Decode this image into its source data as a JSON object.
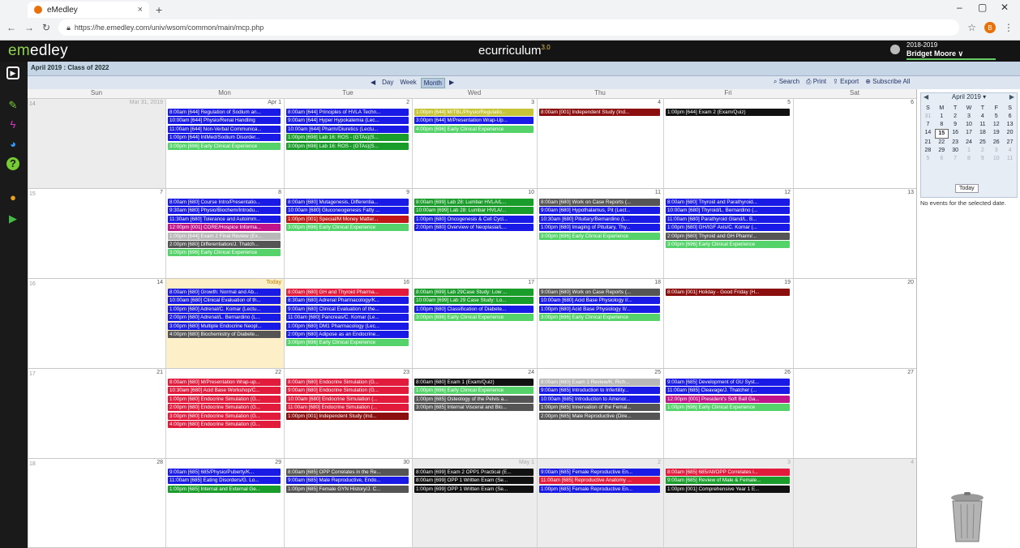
{
  "browser": {
    "tab_title": "eMedley",
    "tab_close": "×",
    "new_tab": "+",
    "url": "https://he.emedley.com/univ/wsom/common/main/mcp.php",
    "profile_initial": "B"
  },
  "app": {
    "logo_em": "em",
    "logo_rest": "edley",
    "title": "ecurriculum",
    "title_sup": "3.0",
    "year": "2018-2019",
    "user": "Bridget Moore ∨"
  },
  "breadcrumb": "April 2019 : Class of 2022",
  "views": {
    "prev": "◀",
    "day": "Day",
    "week": "Week",
    "month": "Month",
    "next": "▶"
  },
  "tools": {
    "search": "Search",
    "print": "Print",
    "export": "Export",
    "subscribe": "Subscribe All"
  },
  "day_headers": [
    "Sun",
    "Mon",
    "Tue",
    "Wed",
    "Thu",
    "Fri",
    "Sat"
  ],
  "weeks": [
    {
      "num": "14",
      "days": [
        {
          "num": "Mar 31, 2019",
          "grey": true,
          "events": []
        },
        {
          "num": "Apr 1",
          "events": [
            {
              "t": "8:00am [644] Regulation of Sodium an...",
              "c": "#1a1ae6"
            },
            {
              "t": "10:00am [644] Physio/Renal Handling",
              "c": "#1a1ae6"
            },
            {
              "t": "11:00am [644] Non-Verbal Communica...",
              "c": "#1a1ae6"
            },
            {
              "t": "1:00pm [644] IntMed/Sodium Disorder...",
              "c": "#1a1ae6"
            },
            {
              "t": "3:00pm [696] Early Clinical Experience",
              "c": "#55d36a"
            }
          ]
        },
        {
          "num": "2",
          "events": [
            {
              "t": "8:00am [644] Principles of HVLA Techn...",
              "c": "#1a1ae6"
            },
            {
              "t": "9:00am [644] Hyper Hypokalemia (Lec...",
              "c": "#1a1ae6"
            },
            {
              "t": "10:00am [644] Pharm/Diuretics (Lectu...",
              "c": "#1a1ae6"
            },
            {
              "t": "1:00pm [698] Lab 16: ROS - (GTAs)(S...",
              "c": "#1b9d2c"
            },
            {
              "t": "3:00pm [698] Lab 16: ROS - (GTAs)(S...",
              "c": "#1b9d2c"
            }
          ]
        },
        {
          "num": "3",
          "events": [
            {
              "t": "1:00pm [644] M/TBL/Physio/Regulatio...",
              "c": "#c8c43a"
            },
            {
              "t": "3:00pm [644] M/Presentation Wrap-Up...",
              "c": "#1a1ae6"
            },
            {
              "t": "4:00pm [696] Early Clinical Experience",
              "c": "#55d36a"
            }
          ]
        },
        {
          "num": "4",
          "events": [
            {
              "t": "8:00am [001] Independent Study (Ind...",
              "c": "#8b0f0f"
            }
          ]
        },
        {
          "num": "5",
          "events": [
            {
              "t": "1:00pm [644] Exam 2 (Exam/Quiz)",
              "c": "#111111"
            }
          ]
        },
        {
          "num": "6",
          "events": []
        }
      ]
    },
    {
      "num": "15",
      "days": [
        {
          "num": "7",
          "events": []
        },
        {
          "num": "8",
          "events": [
            {
              "t": "8:00am [680] Course Intro/Presentatio...",
              "c": "#1a1ae6"
            },
            {
              "t": "9:30am [680] Physio/Biochem/Introdu...",
              "c": "#1a1ae6"
            },
            {
              "t": "11:30am [680] Tolerance and Autoimm...",
              "c": "#1a1ae6"
            },
            {
              "t": "12:00pm [001] CORE/Hospice Informa...",
              "c": "#c0148a"
            },
            {
              "t": "1:00pm [644] Exam 2 Final Review (Ex...",
              "c": "#b8b8b8"
            },
            {
              "t": "2:00pm [680] Differentiation/J. Thatch...",
              "c": "#555555"
            },
            {
              "t": "3:00pm [696] Early Clinical Experience",
              "c": "#55d36a"
            }
          ]
        },
        {
          "num": "9",
          "events": [
            {
              "t": "8:00am [680] Mutagenesis, Differentia...",
              "c": "#1a1ae6"
            },
            {
              "t": "10:00am [680] Gluconeogenesis Fatty ...",
              "c": "#1a1ae6"
            },
            {
              "t": "1:00pm [001] Special/M Money Matter...",
              "c": "#c01818"
            },
            {
              "t": "3:00pm [696] Early Clinical Experience",
              "c": "#55d36a"
            }
          ]
        },
        {
          "num": "10",
          "events": [
            {
              "t": "8:00am [699] Lab 28: Lumbar HVLA/L...",
              "c": "#1b9d2c"
            },
            {
              "t": "10:00am [699] Lab 28: Lumbar HVLA/...",
              "c": "#1b9d2c"
            },
            {
              "t": "1:00pm [680] Oncogenesis & Cell Cycl...",
              "c": "#1a1ae6"
            },
            {
              "t": "2:00pm [680] Overview of Neoplasia/L...",
              "c": "#1a1ae6"
            }
          ]
        },
        {
          "num": "11",
          "events": [
            {
              "t": "8:00am [680] Work on Case Reports (...",
              "c": "#555555"
            },
            {
              "t": "9:00am [680] Hypothalamus, Pit (Lect...",
              "c": "#1a1ae6"
            },
            {
              "t": "10:30am [680] Pituitary/Bernardino (L...",
              "c": "#1a1ae6"
            },
            {
              "t": "1:00pm [680] Imaging of Pituitary, Thy...",
              "c": "#1a1ae6"
            },
            {
              "t": "3:00pm [696] Early Clinical Experience",
              "c": "#55d36a"
            }
          ]
        },
        {
          "num": "12",
          "events": [
            {
              "t": "8:00am [680] Thyroid and Parathyroid...",
              "c": "#1a1ae6"
            },
            {
              "t": "10:00am [680] Thyroid/L. Bernardino (...",
              "c": "#1a1ae6"
            },
            {
              "t": "11:00am [680] Parathyroid Gland/L. B...",
              "c": "#1a1ae6"
            },
            {
              "t": "1:00pm [680] GH/IGF Axis/C. Komar (...",
              "c": "#1a1ae6"
            },
            {
              "t": "2:00pm [680] Thyroid and GH Pharm/...",
              "c": "#555555"
            },
            {
              "t": "3:00pm [696] Early Clinical Experience",
              "c": "#55d36a"
            }
          ]
        },
        {
          "num": "13",
          "events": []
        }
      ]
    },
    {
      "num": "16",
      "days": [
        {
          "num": "14",
          "events": []
        },
        {
          "num": "15",
          "today": true,
          "label": "Today",
          "events": [
            {
              "t": "8:00am [680] Growth: Normal and Ab...",
              "c": "#1a1ae6"
            },
            {
              "t": "10:00am [680] Clinical Evaluation of th...",
              "c": "#1a1ae6"
            },
            {
              "t": "1:00pm [680] Adrenal/C. Komar (Lectu...",
              "c": "#1a1ae6"
            },
            {
              "t": "2:00pm [680] Adrenal/L. Bernardino (L...",
              "c": "#1a1ae6"
            },
            {
              "t": "3:00pm [680] Multiple Endocrine Neopl...",
              "c": "#1a1ae6"
            },
            {
              "t": "4:00pm [680] Biochemistry of Diabete...",
              "c": "#555555"
            }
          ]
        },
        {
          "num": "16",
          "events": [
            {
              "t": "8:00am [680] GH and Thyroid Pharma...",
              "c": "#e21b3c"
            },
            {
              "t": "8:30am [680] Adrenal Pharmacology/K...",
              "c": "#1a1ae6"
            },
            {
              "t": "9:00am [680] Clinical Evaluation of the...",
              "c": "#1a1ae6"
            },
            {
              "t": "11:00am [680] Pancreas/C. Komar (Le...",
              "c": "#1a1ae6"
            },
            {
              "t": "1:00pm [680] DM1 Pharmacology (Lec...",
              "c": "#1a1ae6"
            },
            {
              "t": "2:00pm [680] Adipose as an Endocrine...",
              "c": "#1a1ae6"
            },
            {
              "t": "3:00pm [696] Early Clinical Experience",
              "c": "#55d36a"
            }
          ]
        },
        {
          "num": "17",
          "events": [
            {
              "t": "8:00am [699] Lab 29Case Study: Low ...",
              "c": "#1b9d2c"
            },
            {
              "t": "10:00am [699] Lab 29 Case Study: Lo...",
              "c": "#1b9d2c"
            },
            {
              "t": "1:00pm [680] Classification of Diabete...",
              "c": "#1a1ae6"
            },
            {
              "t": "3:00pm [696] Early Clinical Experience",
              "c": "#55d36a"
            }
          ]
        },
        {
          "num": "18",
          "events": [
            {
              "t": "9:00am [680] Work on Case Reports (...",
              "c": "#555555"
            },
            {
              "t": "10:00am [680] Acid Base Physiology I/...",
              "c": "#1a1ae6"
            },
            {
              "t": "1:00pm [680] Acid Base Physiology II/...",
              "c": "#1a1ae6"
            },
            {
              "t": "3:00pm [696] Early Clinical Experience",
              "c": "#55d36a"
            }
          ]
        },
        {
          "num": "19",
          "events": [
            {
              "t": "8:00am [001] Holiday - Good Friday (H...",
              "c": "#8b0f0f"
            }
          ]
        },
        {
          "num": "20",
          "events": []
        }
      ]
    },
    {
      "num": "17",
      "days": [
        {
          "num": "21",
          "events": []
        },
        {
          "num": "22",
          "events": [
            {
              "t": "8:00am [680] M/Presentation Wrap-up...",
              "c": "#e21b3c"
            },
            {
              "t": "10:30am [680] Acid Base Workshop/C...",
              "c": "#e21b3c"
            },
            {
              "t": "1:00pm [680] Endocrine Simulation (G...",
              "c": "#e21b3c"
            },
            {
              "t": "2:00pm [680] Endocrine Simulation (G...",
              "c": "#e21b3c"
            },
            {
              "t": "3:00pm [680] Endocrine Simulation (G...",
              "c": "#e21b3c"
            },
            {
              "t": "4:00pm [680] Endocrine Simulation (G...",
              "c": "#e21b3c"
            }
          ]
        },
        {
          "num": "23",
          "events": [
            {
              "t": "8:00am [680] Endocrine Simulation (G...",
              "c": "#e21b3c"
            },
            {
              "t": "9:00am [680] Endocrine Simulation (G...",
              "c": "#e21b3c"
            },
            {
              "t": "10:00am [680] Endocrine Simulation (...",
              "c": "#e21b3c"
            },
            {
              "t": "11:00am [680] Endocrine Simulation (...",
              "c": "#e21b3c"
            },
            {
              "t": "1:00pm [001] Independent Study (Ind...",
              "c": "#8b0f0f"
            }
          ]
        },
        {
          "num": "24",
          "events": [
            {
              "t": "8:00am [680] Exam 1 (Exam/Quiz)",
              "c": "#111111"
            },
            {
              "t": "1:00pm [696] Early Clinical Experience",
              "c": "#55d36a"
            },
            {
              "t": "1:00pm [685] Osteology of the Pelvis a...",
              "c": "#555555"
            },
            {
              "t": "3:00pm [685] Internal Visceral and Blo...",
              "c": "#555555"
            }
          ]
        },
        {
          "num": "25",
          "events": [
            {
              "t": "8:00am [680] Exam 1 Review/K. Rich...",
              "c": "#b8b8b8"
            },
            {
              "t": "9:00am [685] Introduction to Infertility...",
              "c": "#1a1ae6"
            },
            {
              "t": "10:00am [685] Introduction to Amenor...",
              "c": "#1a1ae6"
            },
            {
              "t": "1:00pm [685] Innervation of the Femal...",
              "c": "#555555"
            },
            {
              "t": "2:00pm [685] Male Reproductive (Dire...",
              "c": "#555555"
            }
          ]
        },
        {
          "num": "26",
          "events": [
            {
              "t": "9:00am [685] Development of GU Syst...",
              "c": "#1a1ae6"
            },
            {
              "t": "11:00am [685] Cleavage/J. Thatcher (...",
              "c": "#1a1ae6"
            },
            {
              "t": "12:00pm [001] President's Soft Ball Ga...",
              "c": "#c0148a"
            },
            {
              "t": "1:00pm [696] Early Clinical Experience",
              "c": "#55d36a"
            }
          ]
        },
        {
          "num": "27",
          "events": []
        }
      ]
    },
    {
      "num": "18",
      "days": [
        {
          "num": "28",
          "events": []
        },
        {
          "num": "29",
          "events": [
            {
              "t": "9:00am [685] 685/Physio/Puberty/K...",
              "c": "#1a1ae6"
            },
            {
              "t": "11:00am [685] Eating Disorders/G. Lo...",
              "c": "#1a1ae6"
            },
            {
              "t": "1:00pm [685] Internal and External Ge...",
              "c": "#1b9d2c"
            }
          ]
        },
        {
          "num": "30",
          "events": [
            {
              "t": "8:00am [685] OPP Correlates in the Re...",
              "c": "#555555"
            },
            {
              "t": "9:00am [685] Male Reproductive, Endo...",
              "c": "#1a1ae6"
            },
            {
              "t": "1:00pm [685] Female GYN History/J. C...",
              "c": "#555555"
            }
          ]
        },
        {
          "num": "May 1",
          "grey": true,
          "events": [
            {
              "t": "8:00am [699] Exam 2 OPP1 Practical (E...",
              "c": "#111111"
            },
            {
              "t": "8:00am [699] OPP 1 Written Exam (Se...",
              "c": "#111111"
            },
            {
              "t": "1:00pm [699] OPP 1 Written Exam (Se...",
              "c": "#111111"
            }
          ]
        },
        {
          "num": "2",
          "grey": true,
          "events": [
            {
              "t": "9:00am [685] Female Reproductive En...",
              "c": "#1a1ae6"
            },
            {
              "t": "11:00am [685] Reproductive Anatomy ...",
              "c": "#e21b3c"
            },
            {
              "t": "1:00pm [685] Female Reproductive En...",
              "c": "#1a1ae6"
            }
          ]
        },
        {
          "num": "3",
          "grey": true,
          "events": [
            {
              "t": "8:00am [685] 685/All/OPP Correlates i...",
              "c": "#e21b3c"
            },
            {
              "t": "9:00am [685] Review of Male & Female...",
              "c": "#1b9d2c"
            },
            {
              "t": "1:00pm [001] Comprehensive Year 1 E...",
              "c": "#111111"
            }
          ]
        },
        {
          "num": "4",
          "grey": true,
          "events": []
        }
      ]
    }
  ],
  "minical": {
    "title": "April 2019 ▾",
    "prev": "◀",
    "next": "▶",
    "dow": [
      "S",
      "M",
      "T",
      "W",
      "T",
      "F",
      "S"
    ],
    "rows": [
      [
        "31",
        "1",
        "2",
        "3",
        "4",
        "5",
        "6"
      ],
      [
        "7",
        "8",
        "9",
        "10",
        "11",
        "12",
        "13"
      ],
      [
        "14",
        "15",
        "16",
        "17",
        "18",
        "19",
        "20"
      ],
      [
        "21",
        "22",
        "23",
        "24",
        "25",
        "26",
        "27"
      ],
      [
        "28",
        "29",
        "30",
        "1",
        "2",
        "3",
        "4"
      ],
      [
        "5",
        "6",
        "7",
        "8",
        "9",
        "10",
        "11"
      ]
    ],
    "today_label": "Today",
    "no_events": "No events for the selected date."
  }
}
